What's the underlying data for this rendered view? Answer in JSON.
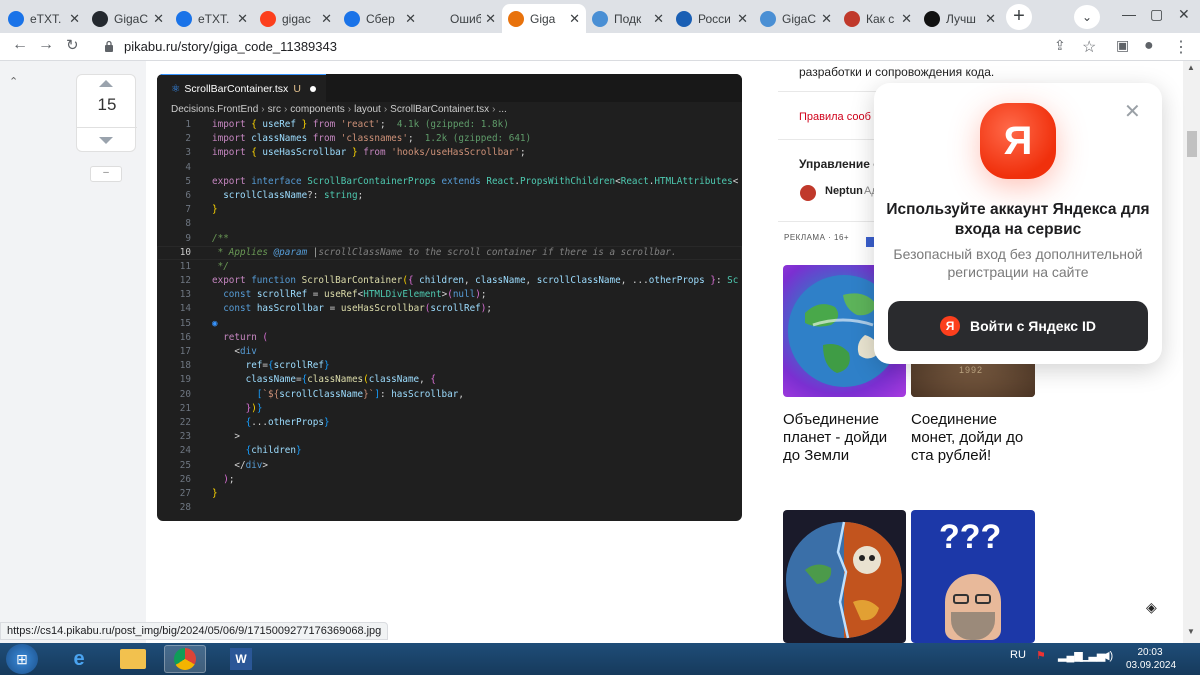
{
  "browser": {
    "tabs": [
      {
        "label": "eTXT.",
        "icon": "etxt-icon",
        "color": "#1a73e8"
      },
      {
        "label": "GigaC",
        "icon": "github-icon",
        "color": "#24292f"
      },
      {
        "label": "eTXT.",
        "icon": "etxt-icon",
        "color": "#1a73e8"
      },
      {
        "label": "gigac",
        "icon": "yandex-icon",
        "color": "#fc3f1d"
      },
      {
        "label": "Сбер",
        "icon": "ai-icon",
        "color": "#1a73e8"
      },
      {
        "label": "Ошибка п",
        "icon": "",
        "color": ""
      },
      {
        "label": "Giga",
        "icon": "pikabu-icon",
        "color": "#e8720c"
      },
      {
        "label": "Подк",
        "icon": "puzzle-icon",
        "color": "#4a8fd4"
      },
      {
        "label": "Росси",
        "icon": "grid-icon",
        "color": "#1a5fb4"
      },
      {
        "label": "GigaC",
        "icon": "puzzle-icon",
        "color": "#4a8fd4"
      },
      {
        "label": "Как с",
        "icon": "habr-icon",
        "color": "#c0392b"
      },
      {
        "label": "Лучш",
        "icon": "plus-icon",
        "color": "#111"
      }
    ],
    "url": "pikabu.ru/story/giga_code_11389343",
    "status_url": "https://cs14.pikabu.ru/post_img/big/2024/05/06/9/1715009277176369068.jpg"
  },
  "vote": {
    "count": "15",
    "collapse": "–"
  },
  "code": {
    "tab_name": "ScrollBarContainer.tsx",
    "tab_badge": "U",
    "breadcrumb": [
      "Decisions.FrontEnd",
      "src",
      "components",
      "layout",
      "ScrollBarContainer.tsx",
      "..."
    ],
    "line_numbers": [
      "1",
      "2",
      "3",
      "4",
      "5",
      "6",
      "7",
      "8",
      "9",
      "10",
      "11",
      "12",
      "13",
      "14",
      "15",
      "16",
      "17",
      "18",
      "19",
      "20",
      "21",
      "22",
      "23",
      "24",
      "25",
      "26",
      "27",
      "28"
    ]
  },
  "sidebar": {
    "top_text": "разработки и сопровождения кода.",
    "rules_link": "Правила сооб",
    "manage_title": "Управление с",
    "user_name": "Neptun",
    "user_suffix": "Ад",
    "ad_label": "РЕКЛАМА · 16+",
    "cards": [
      {
        "caption": "Объединение планет - дойди до Земли"
      },
      {
        "caption": "Соединение монет, дойди до ста рублей!"
      }
    ],
    "coin_text": "1992"
  },
  "yandex_popup": {
    "logo_letter": "Я",
    "title": "Используйте аккаунт Яндекса для входа на сервис",
    "subtitle": "Безопасный вход без дополнительной регистрации на сайте",
    "button_label": "Войти с Яндекс ID",
    "button_icon_letter": "Я"
  },
  "taskbar": {
    "lang": "RU",
    "time": "20:03",
    "date": "03.09.2024"
  }
}
